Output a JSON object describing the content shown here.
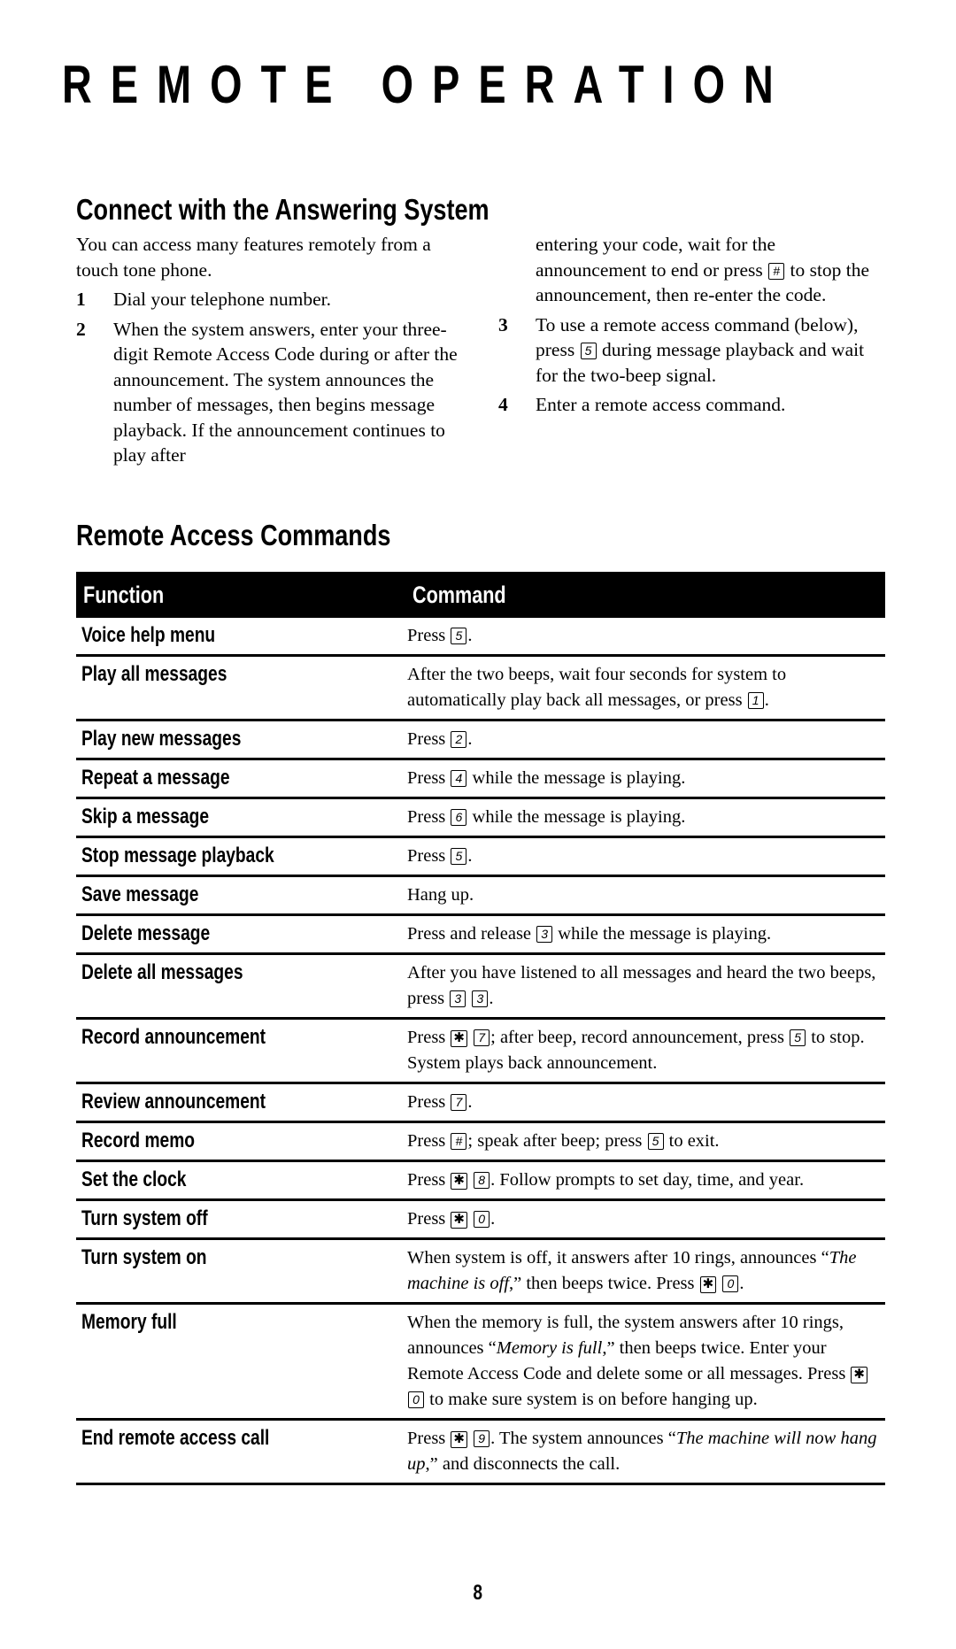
{
  "page": {
    "title": "REMOTE OPERATION",
    "page_number": "8"
  },
  "connect": {
    "heading": "Connect with the Answering System",
    "intro": "You can access many features remotely from a touch tone phone.",
    "steps": [
      {
        "num": "1",
        "text": "Dial your telephone number."
      },
      {
        "num": "2",
        "text_before_key": "When the system answers, enter your three-digit Remote Access Code during or after the announcement. The system announces the number of messages, then begins message playback.  If the announcement continues to play after",
        "continued_before_key": "entering your code, wait for the announcement to end or press",
        "key": "#",
        "continued_after_key": "to stop the announcement, then re-enter the code."
      },
      {
        "num": "3",
        "text_before_key": "To use a remote access command (below), press",
        "key": "5",
        "text_after_key": "during message playback and wait for the two-beep signal."
      },
      {
        "num": "4",
        "text": "Enter a remote access command."
      }
    ]
  },
  "commands": {
    "heading": "Remote Access Commands",
    "columns": [
      "Function",
      "Command"
    ],
    "rows": [
      {
        "function": "Voice help menu",
        "command": [
          {
            "t": "Press "
          },
          {
            "k": "5"
          },
          {
            "t": "."
          }
        ]
      },
      {
        "function": "Play all messages",
        "command": [
          {
            "t": "After the two beeps, wait four seconds for system to automatically play back all messages, or press "
          },
          {
            "k": "1"
          },
          {
            "t": "."
          }
        ]
      },
      {
        "function": "Play new messages",
        "command": [
          {
            "t": "Press "
          },
          {
            "k": "2"
          },
          {
            "t": "."
          }
        ]
      },
      {
        "function": "Repeat a message",
        "command": [
          {
            "t": "Press "
          },
          {
            "k": "4"
          },
          {
            "t": " while the message is playing."
          }
        ]
      },
      {
        "function": "Skip a message",
        "command": [
          {
            "t": "Press "
          },
          {
            "k": "6"
          },
          {
            "t": " while the message is playing."
          }
        ]
      },
      {
        "function": "Stop message playback",
        "command": [
          {
            "t": "Press "
          },
          {
            "k": "5"
          },
          {
            "t": "."
          }
        ]
      },
      {
        "function": "Save message",
        "command": [
          {
            "t": "Hang up."
          }
        ]
      },
      {
        "function": "Delete message",
        "command": [
          {
            "t": "Press and release "
          },
          {
            "k": "3"
          },
          {
            "t": " while the message is playing."
          }
        ]
      },
      {
        "function": "Delete all messages",
        "command": [
          {
            "t": "After you have listened to all messages and heard the two beeps, press "
          },
          {
            "k": "3"
          },
          {
            "t": " "
          },
          {
            "k": "3"
          },
          {
            "t": "."
          }
        ]
      },
      {
        "function": "Record announcement",
        "command": [
          {
            "t": "Press "
          },
          {
            "k": "✱"
          },
          {
            "t": " "
          },
          {
            "k": "7"
          },
          {
            "t": "; after beep, record announcement, press "
          },
          {
            "k": "5"
          },
          {
            "t": " to stop.  System plays back announcement."
          }
        ]
      },
      {
        "function": "Review announcement",
        "command": [
          {
            "t": "Press "
          },
          {
            "k": "7"
          },
          {
            "t": "."
          }
        ]
      },
      {
        "function": "Record memo",
        "command": [
          {
            "t": "Press "
          },
          {
            "k": "#"
          },
          {
            "t": "; speak after beep; press "
          },
          {
            "k": "5"
          },
          {
            "t": " to exit."
          }
        ]
      },
      {
        "function": "Set the clock",
        "command": [
          {
            "t": "Press "
          },
          {
            "k": "✱"
          },
          {
            "t": " "
          },
          {
            "k": "8"
          },
          {
            "t": ".  Follow prompts to set day, time, and year."
          }
        ]
      },
      {
        "function": "Turn system off",
        "command": [
          {
            "t": "Press "
          },
          {
            "k": "✱"
          },
          {
            "t": " "
          },
          {
            "k": "0"
          },
          {
            "t": "."
          }
        ]
      },
      {
        "function": "Turn system on",
        "command": [
          {
            "t": "When system is off, it answers after 10 rings, announces “"
          },
          {
            "i": "The machine is off"
          },
          {
            "t": ",” then beeps twice. Press "
          },
          {
            "k": "✱"
          },
          {
            "t": " "
          },
          {
            "k": "0"
          },
          {
            "t": "."
          }
        ]
      },
      {
        "function": "Memory full",
        "command": [
          {
            "t": "When the memory is full, the system answers after 10 rings, announces “"
          },
          {
            "i": "Memory is full"
          },
          {
            "t": ",” then beeps twice.  Enter your Remote Access Code and delete some or all messages.  Press "
          },
          {
            "k": "✱"
          },
          {
            "t": " "
          },
          {
            "k": "0"
          },
          {
            "t": " to make sure system is on before hanging up."
          }
        ]
      },
      {
        "function": "End remote access call",
        "command": [
          {
            "t": "Press "
          },
          {
            "k": "✱"
          },
          {
            "t": " "
          },
          {
            "k": "9"
          },
          {
            "t": ". The system announces “"
          },
          {
            "i": "The machine will now hang up"
          },
          {
            "t": ",” and disconnects the call."
          }
        ]
      }
    ]
  }
}
